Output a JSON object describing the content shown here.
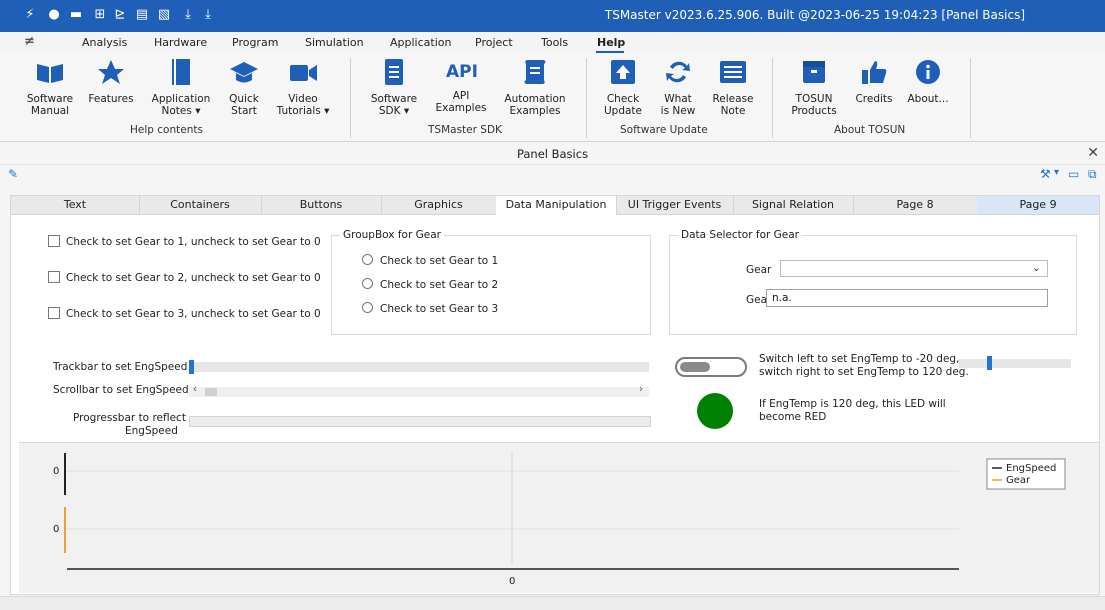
{
  "window": {
    "title": "TSMaster v2023.6.25.906. Built @2023-06-25 19:04:23 [Panel Basics]"
  },
  "menu": [
    "Analysis",
    "Hardware",
    "Program",
    "Simulation",
    "Application",
    "Project",
    "Tools",
    "Help"
  ],
  "ribbon": {
    "buttons": [
      {
        "label1": "Software",
        "label2": "Manual",
        "icon": "book-icon"
      },
      {
        "label1": "Features",
        "label2": "",
        "icon": "star-icon"
      },
      {
        "label1": "Application",
        "label2": "Notes ▾",
        "icon": "notebook-icon"
      },
      {
        "label1": "Quick",
        "label2": "Start",
        "icon": "graduation-cap-icon"
      },
      {
        "label1": "Video",
        "label2": "Tutorials ▾",
        "icon": "video-camera-icon"
      },
      {
        "label1": "Software",
        "label2": "SDK ▾",
        "icon": "document-icon"
      },
      {
        "label1": "API",
        "label2": "Examples",
        "icon": "api-icon"
      },
      {
        "label1": "Automation",
        "label2": "Examples",
        "icon": "script-icon"
      },
      {
        "label1": "Check",
        "label2": "Update",
        "icon": "upload-icon"
      },
      {
        "label1": "What",
        "label2": "is New",
        "icon": "sync-icon"
      },
      {
        "label1": "Release",
        "label2": "Note",
        "icon": "notes-icon"
      },
      {
        "label1": "TOSUN",
        "label2": "Products",
        "icon": "box-icon"
      },
      {
        "label1": "Credits",
        "label2": "",
        "icon": "thumbs-up-icon"
      },
      {
        "label1": "About...",
        "label2": "",
        "icon": "info-icon"
      }
    ],
    "groups": [
      "Help contents",
      "TSMaster SDK",
      "Software Update",
      "About TOSUN"
    ]
  },
  "panel": {
    "title": "Panel Basics"
  },
  "tabs": [
    "Text",
    "Containers",
    "Buttons",
    "Graphics",
    "Data Manipulation",
    "UI Trigger Events",
    "Signal Relation",
    "Page 8",
    "Page 9"
  ],
  "checkboxes": [
    "Check to set Gear to 1, uncheck to set Gear to 0",
    "Check to set Gear to 2, uncheck to set Gear to 0",
    "Check to set Gear to 3, uncheck to set Gear to 0"
  ],
  "groupbox_gear": {
    "title": "GroupBox for Gear",
    "options": [
      "Check to set Gear to 1",
      "Check to set Gear to 2",
      "Check to set Gear to 3"
    ]
  },
  "data_selector": {
    "title": "Data Selector for Gear",
    "label1": "Gear",
    "label2": "Gear",
    "value2": "n.a."
  },
  "controls": {
    "trackbar_label": "Trackbar to set EngSpeed",
    "scrollbar_label": "Scrollbar to set EngSpeed",
    "progress_label1": "Progressbar to reflect",
    "progress_label2": "EngSpeed",
    "switch_text1": "Switch left to set EngTemp to -20 deg,",
    "switch_text2": "switch right to set EngTemp to 120 deg.",
    "led_text1": "If EngTemp is 120 deg, this LED will",
    "led_text2": "become RED",
    "led_color": "#008000",
    "accent": "#1f74d4"
  },
  "chart_data": {
    "type": "line",
    "series": [
      {
        "name": "EngSpeed",
        "color": "#222222",
        "values": [
          0
        ]
      },
      {
        "name": "Gear",
        "color": "#f0a030",
        "values": [
          0
        ]
      }
    ],
    "x": [
      0
    ],
    "upper_ytick": "0",
    "lower_ytick": "0",
    "xtick": "0",
    "legend": "top-right"
  }
}
